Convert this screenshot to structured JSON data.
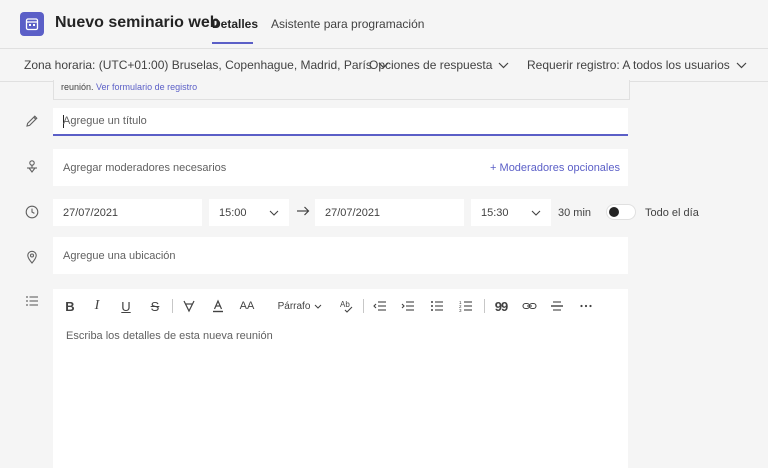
{
  "header": {
    "title": "Nuevo seminario web",
    "tabs": [
      {
        "label": "Detalles",
        "active": true
      },
      {
        "label": "Asistente para programación",
        "active": false
      }
    ]
  },
  "options": {
    "timezone": "Zona horaria: (UTC+01:00) Bruselas, Copenhague, Madrid, París",
    "response": "Opciones de respuesta",
    "registration": "Requerir registro: A todos los usuarios"
  },
  "notice": {
    "text": "reunión.",
    "link": "Ver formulario de registro"
  },
  "form": {
    "title_placeholder": "Agregue un título",
    "moderators_placeholder": "Agregar moderadores necesarios",
    "optional_moderators": "+ Moderadores opcionales",
    "start_date": "27/07/2021",
    "start_time": "15:00",
    "end_date": "27/07/2021",
    "end_time": "15:30",
    "duration": "30 min",
    "all_day_label": "Todo el día",
    "all_day": false,
    "location_placeholder": "Agregue una ubicación",
    "details_placeholder": "Escriba los detalles de esta nueva reunión"
  },
  "toolbar": {
    "bold": "B",
    "italic": "I",
    "underline": "U",
    "strike": "S",
    "font_size": "AA",
    "paragraph": "Párrafo",
    "quote": "99"
  },
  "colors": {
    "accent": "#5b5fc7",
    "background": "#f5f5f5",
    "surface": "#ffffff"
  }
}
